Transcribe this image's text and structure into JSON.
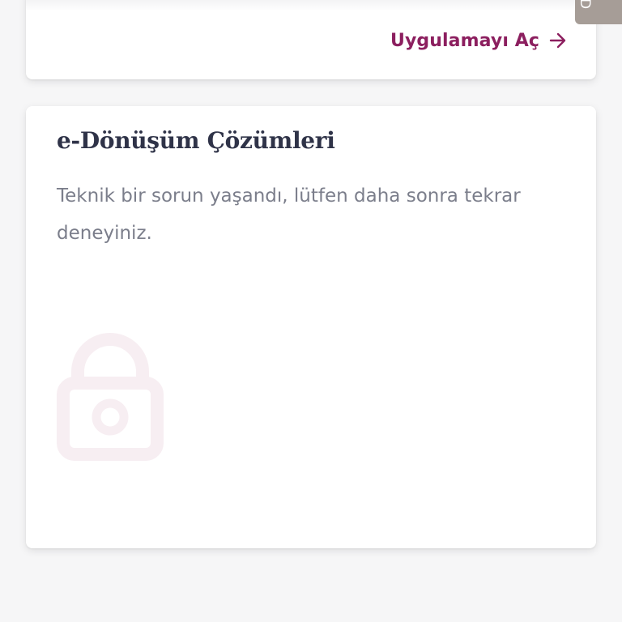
{
  "app_card": {
    "open_app_label": "Uygulamayı Aç",
    "arrow_icon": "arrow-right-icon",
    "accent_color": "#8c1f5f"
  },
  "solutions_card": {
    "title": "e-Dönüşüm Çözümleri",
    "message": "Teknik bir sorun yaşandı, lütfen daha sonra tekrar deneyiniz.",
    "placeholder_icon": "lock-icon",
    "placeholder_icon_color": "#f7eef2"
  },
  "side_tab": {
    "label": "D",
    "color": "#a69d97"
  }
}
